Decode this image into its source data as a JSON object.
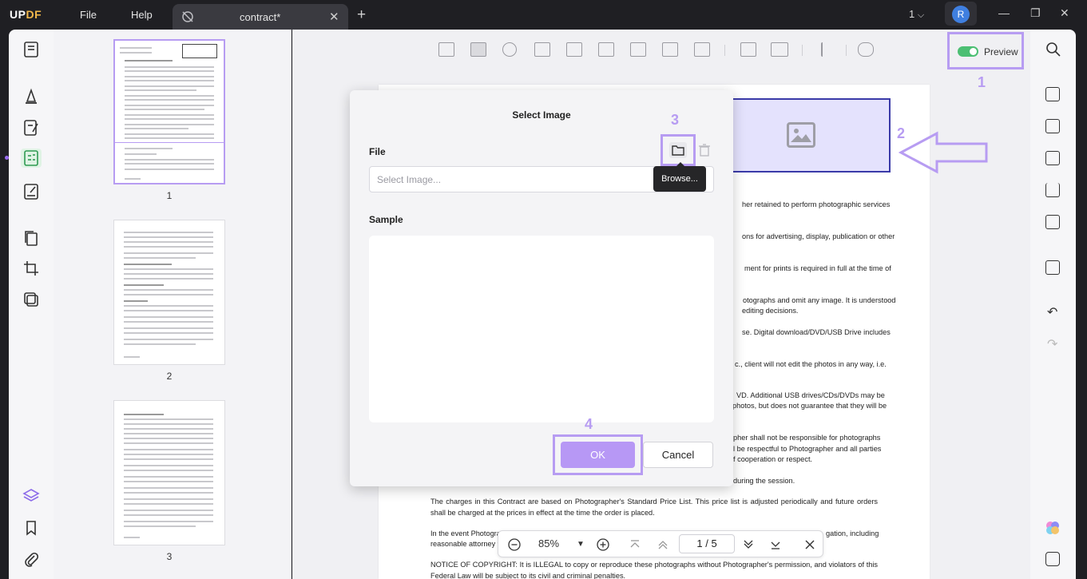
{
  "app": {
    "logo_part1": "UP",
    "logo_part2": "DF",
    "menu": [
      "File",
      "Help"
    ],
    "tab_title": "contract*",
    "page_indicator": "1",
    "avatar_letter": "R",
    "accent": "#b79cf2"
  },
  "toolbar": {
    "preview_label": "Preview",
    "preview_on": true
  },
  "callouts": [
    "1",
    "2",
    "3",
    "4"
  ],
  "thumbnails": [
    {
      "number": "1",
      "selected": true
    },
    {
      "number": "2",
      "selected": false
    },
    {
      "number": "3",
      "selected": false
    }
  ],
  "document": {
    "line_fragments": [
      "her retained to perform photographic services",
      "ons for advertising, display, publication or other",
      "ment for prints is required in full at the time of",
      "otographs and omit any image. It is understood",
      "editing decisions.",
      "se. Digital download/DVD/USB Drive includes",
      "c., client will not edit the photos in any way, i.e.",
      "VD. Additional USB drives/CDs/DVDs may be",
      "photos, but does not guarantee that they will be",
      "pher shall not be responsible for photographs",
      "l be respectful to Photographer and all parties",
      "f cooperation or respect.",
      "during the session."
    ],
    "para_charges": "The charges in this Contract are based on Photographer's Standard Price List. This price list is adjusted periodically and future orders shall be charged at the prices in effect at the time the order is placed.",
    "para_event_left": "In the event Photographer",
    "para_event_right": "gation, including",
    "para_event_line2": "reasonable attorney fe",
    "para_notice": "NOTICE OF COPYRIGHT: It is ILLEGAL to copy or reproduce these photographs without Photographer's permission, and violators of this Federal Law will be subject to its civil and criminal penalties."
  },
  "zoombar": {
    "zoom": "85%",
    "current_page": "1",
    "separator": "/",
    "total_pages": "5"
  },
  "dialog": {
    "title": "Select Image",
    "file_label": "File",
    "file_placeholder": "Select Image...",
    "browse_tooltip": "Browse...",
    "sample_label": "Sample",
    "ok_label": "OK",
    "cancel_label": "Cancel"
  }
}
